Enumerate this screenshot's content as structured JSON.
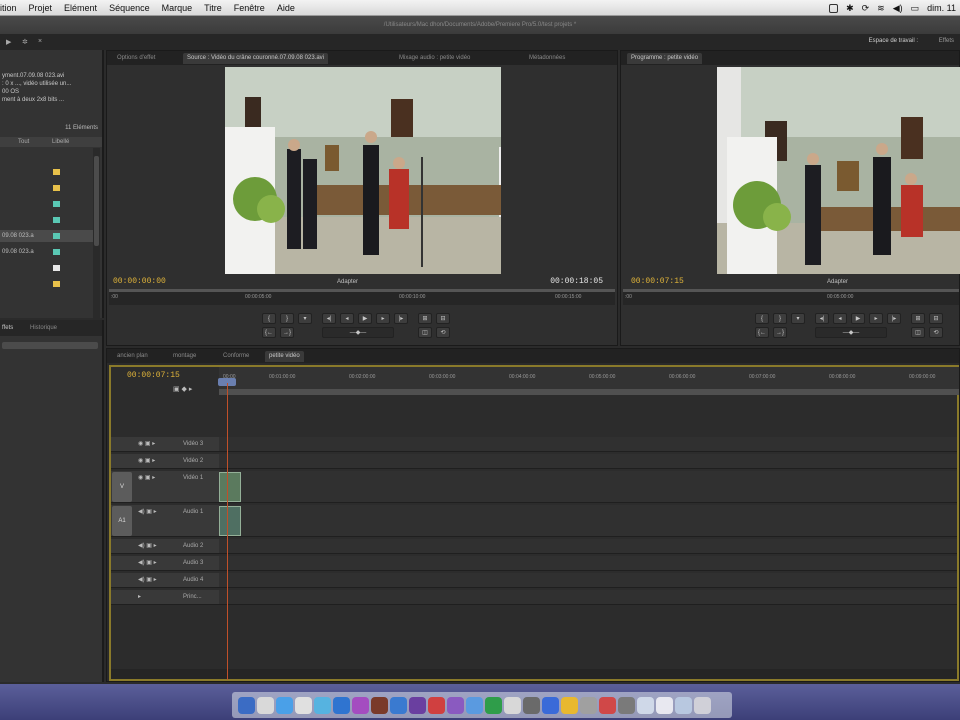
{
  "menubar": {
    "items": [
      "ition",
      "Projet",
      "Elément",
      "Séquence",
      "Marque",
      "Titre",
      "Fenêtre",
      "Aide"
    ],
    "clock": "dim. 11"
  },
  "window": {
    "title": "/Utilisateurs/Mac dhon/Documents/Adobe/Premiere Pro/5.0/test projets *"
  },
  "toolbar": {
    "workspace_label": "Espace de travail :",
    "effects_label": "Effets"
  },
  "project_panel": {
    "clip_name": "yment.07.09.08 023.avi",
    "info_line1": ": 0 x ..., vidéo utilisée un...",
    "info_line2": "00 OS",
    "info_line3": "ment à deux 2x8 bits ...",
    "item_count": "11 Eléments",
    "col_headers": [
      "Tout",
      "Libellé"
    ],
    "items": [
      {
        "name": "",
        "color": "#e8c14a"
      },
      {
        "name": "",
        "color": "#e8c14a"
      },
      {
        "name": "",
        "color": "#5ac8b4"
      },
      {
        "name": "",
        "color": "#5ac8b4"
      },
      {
        "name": "09.08 023.a",
        "color": "#5ac8b4"
      },
      {
        "name": "09.08 023.a",
        "color": "#5ac8b4"
      },
      {
        "name": "",
        "color": "#e8e8e8"
      },
      {
        "name": "",
        "color": "#e8c14a"
      }
    ]
  },
  "effects_panel": {
    "tabs": [
      "ffets",
      "Historique"
    ]
  },
  "source_monitor": {
    "tabs": [
      "Options d'effet",
      "Source : Vidéo du crâne couronné.07.09.08 023.avi",
      "Mixage audio : petite vidéo",
      "Métadonnées"
    ],
    "timecode_in": "00:00:00:00",
    "timecode_out": "00:00:18:05",
    "fit": "Adapter",
    "ruler": [
      ":00",
      "00:00:05:00",
      "00:00:10:00",
      "00:00:15:00"
    ]
  },
  "program_monitor": {
    "tabs": [
      "Programme : petite vidéo"
    ],
    "timecode_in": "00:00:07:15",
    "fit": "Adapter",
    "ruler": [
      ":00",
      "00:05:00:00"
    ]
  },
  "timeline": {
    "tabs": [
      "ancien plan",
      "montage",
      "Conforme",
      "petite vidéo"
    ],
    "timecode": "00:00:07:15",
    "ruler": [
      "00:00",
      "00:01:00:00",
      "00:02:00:00",
      "00:03:00:00",
      "00:04:00:00",
      "00:05:00:00",
      "00:06:00:00",
      "00:07:00:00",
      "00:08:00:00",
      "00:09:00:00"
    ],
    "tracks": [
      {
        "name": "Vidéo 3",
        "kind": "video",
        "height": 15
      },
      {
        "name": "Vidéo 2",
        "kind": "video",
        "height": 15
      },
      {
        "name": "Vidéo 1",
        "kind": "video",
        "height": 32,
        "target": "V",
        "clip": true
      },
      {
        "name": "Audio 1",
        "kind": "audio",
        "height": 32,
        "target": "A1",
        "clip": true
      },
      {
        "name": "Audio 2",
        "kind": "audio",
        "height": 15
      },
      {
        "name": "Audio 3",
        "kind": "audio",
        "height": 15
      },
      {
        "name": "Audio 4",
        "kind": "audio",
        "height": 15
      },
      {
        "name": "Princ...",
        "kind": "master",
        "height": 15
      }
    ]
  },
  "colors": {
    "timecode": "#e0b43a",
    "playhead": "#c0502a",
    "accent_border": "#8a7a2a"
  }
}
